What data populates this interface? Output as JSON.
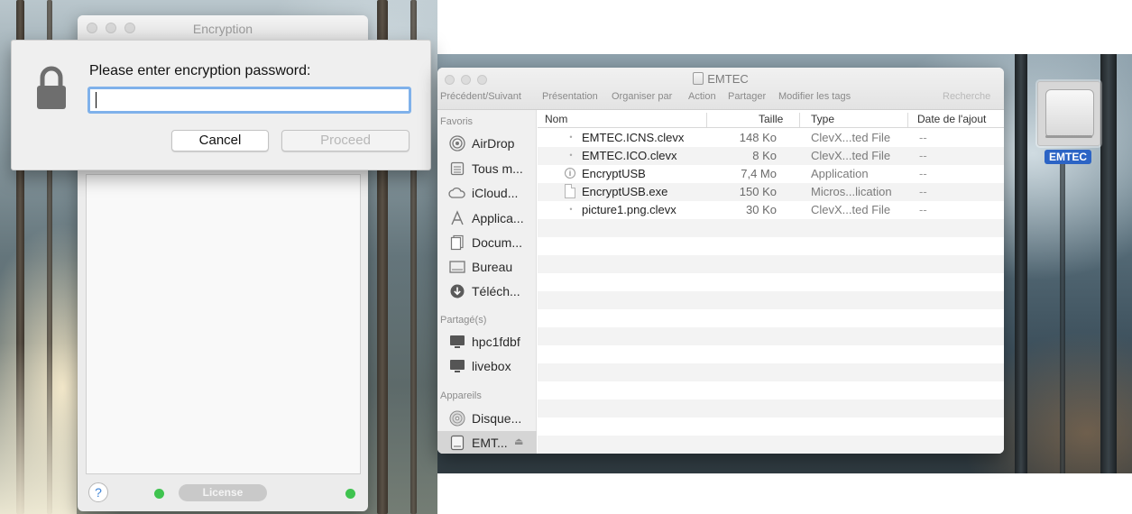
{
  "encryption_app": {
    "title": "Encryption",
    "license_label": "License",
    "help_symbol": "?"
  },
  "password_sheet": {
    "prompt": "Please enter encryption password:",
    "input_value": "",
    "cancel_label": "Cancel",
    "proceed_label": "Proceed"
  },
  "finder": {
    "title": "EMTEC",
    "toolbar": {
      "back_forward": "Précédent/Suivant",
      "view": "Présentation",
      "arrange": "Organiser par",
      "action": "Action",
      "share": "Partager",
      "tags": "Modifier les tags",
      "search": "Recherche"
    },
    "sidebar": {
      "favorites_header": "Favoris",
      "favorites": [
        {
          "label": "AirDrop",
          "icon": "airdrop-icon"
        },
        {
          "label": "Tous m...",
          "icon": "all-files-icon"
        },
        {
          "label": "iCloud...",
          "icon": "icloud-icon"
        },
        {
          "label": "Applica...",
          "icon": "applications-icon"
        },
        {
          "label": "Docum...",
          "icon": "documents-icon"
        },
        {
          "label": "Bureau",
          "icon": "desktop-icon"
        },
        {
          "label": "Téléch...",
          "icon": "downloads-icon"
        }
      ],
      "shared_header": "Partagé(s)",
      "shared": [
        {
          "label": "hpc1fdbf",
          "icon": "computer-icon"
        },
        {
          "label": "livebox",
          "icon": "computer-icon"
        }
      ],
      "devices_header": "Appareils",
      "devices": [
        {
          "label": "Disque...",
          "icon": "disc-icon"
        },
        {
          "label": "EMT...",
          "icon": "external-drive-icon",
          "selected": true
        }
      ]
    },
    "columns": {
      "name": "Nom",
      "size": "Taille",
      "type": "Type",
      "date_added": "Date de l'ajout"
    },
    "files": [
      {
        "name": "EMTEC.ICNS.clevx",
        "size": "148 Ko",
        "type": "ClevX...ted File",
        "date": "--",
        "icon": "encrypted-file-icon"
      },
      {
        "name": "EMTEC.ICO.clevx",
        "size": "8 Ko",
        "type": "ClevX...ted File",
        "date": "--",
        "icon": "encrypted-file-icon"
      },
      {
        "name": "EncryptUSB",
        "size": "7,4 Mo",
        "type": "Application",
        "date": "--",
        "icon": "application-icon"
      },
      {
        "name": "EncryptUSB.exe",
        "size": "150 Ko",
        "type": "Micros...lication",
        "date": "--",
        "icon": "document-icon"
      },
      {
        "name": "picture1.png.clevx",
        "size": "30 Ko",
        "type": "ClevX...ted File",
        "date": "--",
        "icon": "encrypted-file-icon"
      }
    ]
  },
  "desktop": {
    "drive_label": "EMTEC"
  },
  "colors": {
    "accent_blue": "#2c64c5",
    "focus_ring": "#7fb1ea",
    "status_green": "#3fc34f"
  }
}
